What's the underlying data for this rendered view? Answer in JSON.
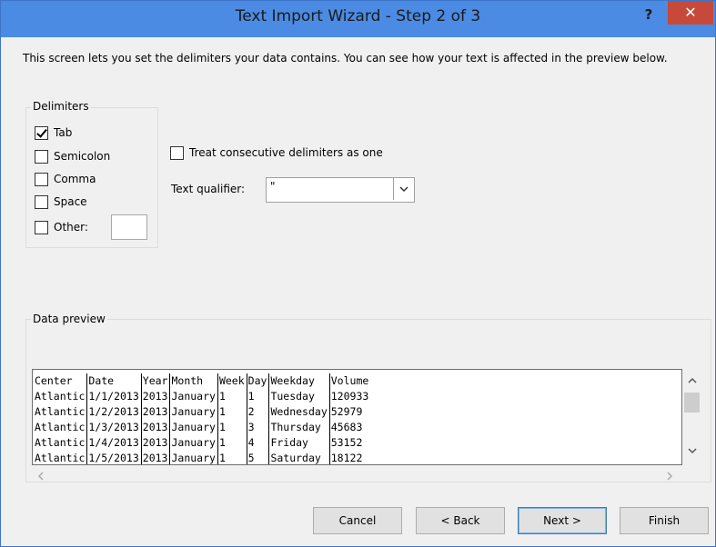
{
  "window": {
    "title": "Text Import Wizard - Step 2 of 3",
    "help_label": "?",
    "close_label": "✕"
  },
  "intro": "This screen lets you set the delimiters your data contains.  You can see how your text is affected in the preview below.",
  "delimiters": {
    "group_label": "Delimiters",
    "tab": {
      "label": "Tab",
      "checked": true
    },
    "semicolon": {
      "label": "Semicolon",
      "checked": false
    },
    "comma": {
      "label": "Comma",
      "checked": false
    },
    "space": {
      "label": "Space",
      "checked": false
    },
    "other": {
      "label": "Other:",
      "checked": false,
      "value": ""
    }
  },
  "consecutive": {
    "label": "Treat consecutive delimiters as one",
    "checked": false
  },
  "qualifier": {
    "label": "Text qualifier:",
    "value": "\""
  },
  "preview": {
    "group_label": "Data preview",
    "rows": [
      [
        "Center",
        "Date",
        "Year",
        "Month",
        "Week",
        "Day",
        "Weekday",
        "Volume"
      ],
      [
        "Atlantic",
        "1/1/2013",
        "2013",
        "January",
        "1",
        "1",
        "Tuesday",
        "120933"
      ],
      [
        "Atlantic",
        "1/2/2013",
        "2013",
        "January",
        "1",
        "2",
        "Wednesday",
        "52979"
      ],
      [
        "Atlantic",
        "1/3/2013",
        "2013",
        "January",
        "1",
        "3",
        "Thursday",
        "45683"
      ],
      [
        "Atlantic",
        "1/4/2013",
        "2013",
        "January",
        "1",
        "4",
        "Friday",
        "53152"
      ],
      [
        "Atlantic",
        "1/5/2013",
        "2013",
        "January",
        "1",
        "5",
        "Saturday",
        "18122"
      ]
    ]
  },
  "buttons": {
    "cancel": "Cancel",
    "back": "< Back",
    "next": "Next >",
    "finish": "Finish"
  },
  "colors": {
    "titlebar": "#4b8be3",
    "close": "#c7493a",
    "dialog_bg": "#f0f0f0"
  }
}
